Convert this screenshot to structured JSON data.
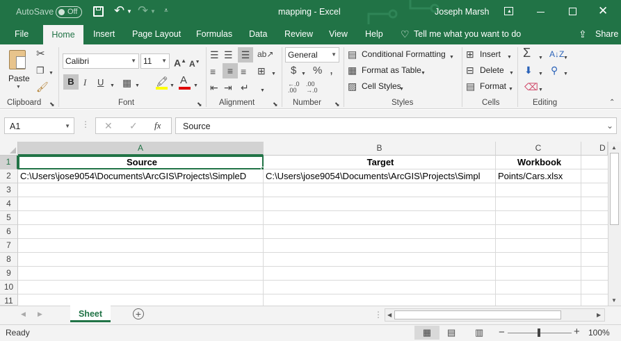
{
  "title": {
    "autosave_label": "AutoSave",
    "autosave_state": "Off",
    "doc_title": "mapping  -  Excel",
    "user_name": "Joseph Marsh"
  },
  "tabs": [
    {
      "label": "File"
    },
    {
      "label": "Home"
    },
    {
      "label": "Insert"
    },
    {
      "label": "Page Layout"
    },
    {
      "label": "Formulas"
    },
    {
      "label": "Data"
    },
    {
      "label": "Review"
    },
    {
      "label": "View"
    },
    {
      "label": "Help"
    }
  ],
  "tell_me": "Tell me what you want to do",
  "share_label": "Share",
  "ribbon": {
    "paste_label": "Paste",
    "font_name": "Calibri",
    "font_size": "11",
    "number_format": "General",
    "conditional_formatting": "Conditional Formatting",
    "format_as_table": "Format as Table",
    "cell_styles": "Cell Styles",
    "insert": "Insert",
    "delete": "Delete",
    "format": "Format",
    "groups": {
      "clipboard": "Clipboard",
      "font": "Font",
      "alignment": "Alignment",
      "number": "Number",
      "styles": "Styles",
      "cells": "Cells",
      "editing": "Editing"
    }
  },
  "formula_bar": {
    "name_box": "A1",
    "fx": "fx",
    "content": "Source"
  },
  "columns": [
    "A",
    "B",
    "C",
    "D"
  ],
  "rows": [
    "1",
    "2",
    "3",
    "4",
    "5",
    "6",
    "7",
    "8",
    "9",
    "10",
    "11"
  ],
  "cells": {
    "A1": "Source",
    "B1": "Target",
    "C1": "Workbook",
    "A2": "C:\\Users\\jose9054\\Documents\\ArcGIS\\Projects\\SimpleD",
    "B2": "C:\\Users\\jose9054\\Documents\\ArcGIS\\Projects\\Simpl",
    "C2": "Points/Cars.xlsx"
  },
  "sheet_tab": "Sheet",
  "status": {
    "ready": "Ready",
    "zoom": "100%"
  },
  "colors": {
    "excel_green": "#217346",
    "ribbon_bg": "#f3f3f3"
  }
}
